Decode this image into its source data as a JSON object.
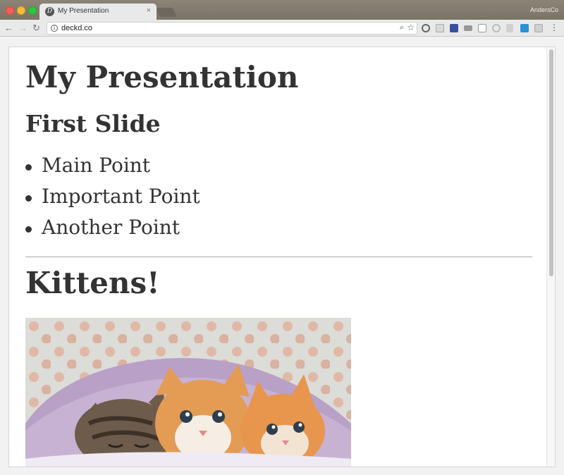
{
  "browser": {
    "tab_title": "My Presentation",
    "tab_close": "×",
    "profile_name": "AndersCo",
    "url": "deckd.co"
  },
  "slides": {
    "title": "My Presentation",
    "first_slide": {
      "heading": "First Slide",
      "points": [
        "Main Point",
        "Important Point",
        "Another Point"
      ]
    },
    "second_slide": {
      "heading": "Kittens!",
      "image": "kittens-photo"
    }
  },
  "colors": {
    "titlebar": "#8d8478",
    "text": "#333333",
    "rule": "#aaaaaa"
  }
}
